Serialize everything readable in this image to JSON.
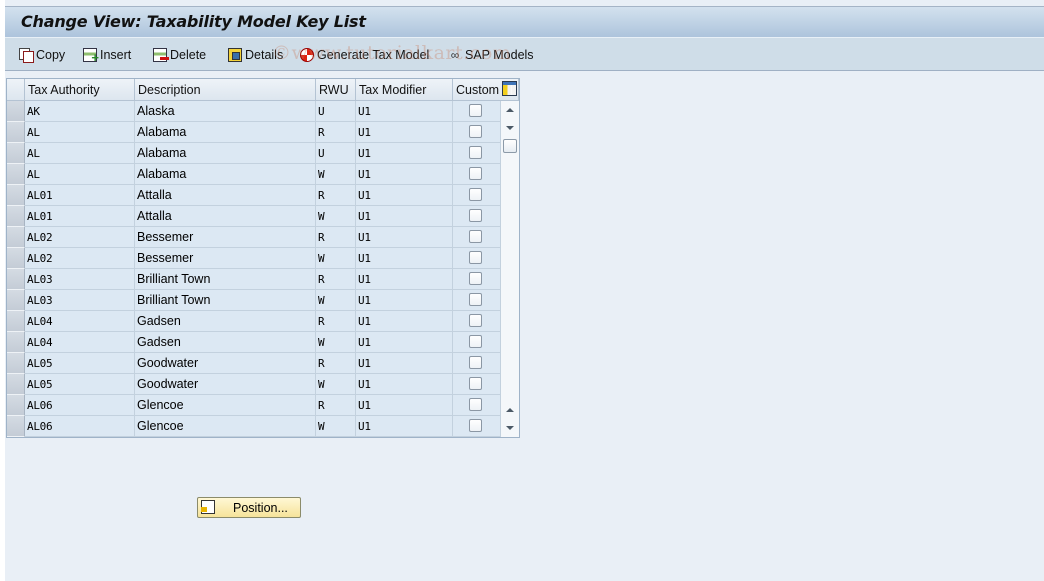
{
  "title": "Change View: Taxability Model Key List",
  "toolbar": {
    "copy": "Copy",
    "insert": "Insert",
    "delete": "Delete",
    "details": "Details",
    "generate": "Generate Tax Model",
    "sap_models": "SAP Models"
  },
  "watermark": "©www.tutorialkart.com",
  "table": {
    "columns": [
      "Tax Authority",
      "Description",
      "RWU",
      "Tax Modifier",
      "Custom"
    ],
    "rows": [
      {
        "authority": "AK",
        "description": "Alaska",
        "rwu": "U",
        "modifier": "U1",
        "custom": false
      },
      {
        "authority": "AL",
        "description": "Alabama",
        "rwu": "R",
        "modifier": "U1",
        "custom": false
      },
      {
        "authority": "AL",
        "description": "Alabama",
        "rwu": "U",
        "modifier": "U1",
        "custom": false
      },
      {
        "authority": "AL",
        "description": "Alabama",
        "rwu": "W",
        "modifier": "U1",
        "custom": false
      },
      {
        "authority": "AL01",
        "description": "Attalla",
        "rwu": "R",
        "modifier": "U1",
        "custom": false
      },
      {
        "authority": "AL01",
        "description": "Attalla",
        "rwu": "W",
        "modifier": "U1",
        "custom": false
      },
      {
        "authority": "AL02",
        "description": "Bessemer",
        "rwu": "R",
        "modifier": "U1",
        "custom": false
      },
      {
        "authority": "AL02",
        "description": "Bessemer",
        "rwu": "W",
        "modifier": "U1",
        "custom": false
      },
      {
        "authority": "AL03",
        "description": "Brilliant Town",
        "rwu": "R",
        "modifier": "U1",
        "custom": false
      },
      {
        "authority": "AL03",
        "description": "Brilliant Town",
        "rwu": "W",
        "modifier": "U1",
        "custom": false
      },
      {
        "authority": "AL04",
        "description": "Gadsen",
        "rwu": "R",
        "modifier": "U1",
        "custom": false
      },
      {
        "authority": "AL04",
        "description": "Gadsen",
        "rwu": "W",
        "modifier": "U1",
        "custom": false
      },
      {
        "authority": "AL05",
        "description": "Goodwater",
        "rwu": "R",
        "modifier": "U1",
        "custom": false
      },
      {
        "authority": "AL05",
        "description": "Goodwater",
        "rwu": "W",
        "modifier": "U1",
        "custom": false
      },
      {
        "authority": "AL06",
        "description": "Glencoe",
        "rwu": "R",
        "modifier": "U1",
        "custom": false
      },
      {
        "authority": "AL06",
        "description": "Glencoe",
        "rwu": "W",
        "modifier": "U1",
        "custom": false
      }
    ]
  },
  "position_button": "Position..."
}
